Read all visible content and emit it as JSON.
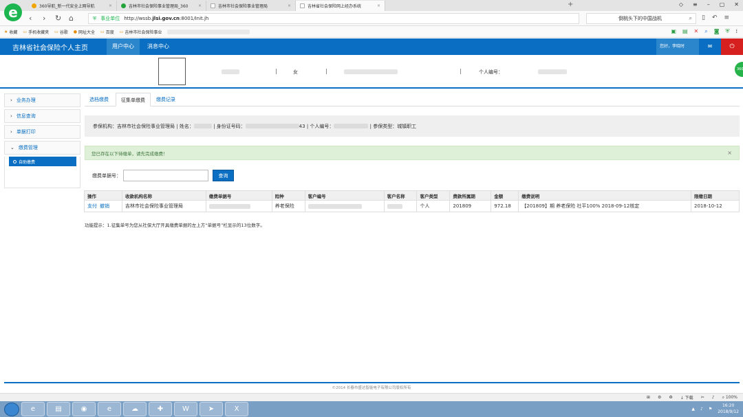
{
  "browser": {
    "tabs": [
      {
        "title": "360导航_新一代安全上网导航",
        "active": false
      },
      {
        "title": "吉林市社会保险事业管理局_360",
        "active": false
      },
      {
        "title": "吉林市社会保险事业管理局",
        "active": false
      },
      {
        "title": "吉林省社会保险网上经办系统",
        "active": true
      }
    ],
    "new_tab": "+",
    "url_secure": "事业单位",
    "url_prefix": "http://wssb.",
    "url_host": "jlsi.gov.cn",
    "url_suffix": ":8001/Init.jh",
    "search_text": "倒桃头下的中国战机",
    "bookmarks": [
      "收藏",
      "手机收藏夹",
      "谷歌",
      "网址大全",
      "百度",
      "吉林市社会保险事业"
    ]
  },
  "site": {
    "title": "吉林省社会保险个人主页",
    "nav": [
      {
        "label": "用户中心",
        "active": true
      },
      {
        "label": "消息中心",
        "active": false
      }
    ],
    "greeting": "您好，李晓时",
    "mail_icon": "envelope-icon",
    "power_icon": "power-icon"
  },
  "profile": {
    "gender": "女",
    "personal_no_label": "个人编号："
  },
  "sidebar": {
    "items": [
      {
        "label": "业务办理"
      },
      {
        "label": "信息查询"
      },
      {
        "label": "单据打印"
      },
      {
        "label": "缴费管理"
      }
    ],
    "sub_item": "自助缴费"
  },
  "main": {
    "tabs": [
      {
        "label": "选档缴费",
        "active": false
      },
      {
        "label": "征集单缴费",
        "active": true
      },
      {
        "label": "缴费记录",
        "active": false
      }
    ],
    "info": {
      "org_label": "参保机构：吉林市社会保险事业管理局",
      "name_label": "| 姓名：",
      "id_label": "| 身份证号码：",
      "id_tail": "43",
      "pno_label": "| 个人编号：",
      "type_label": "| 参保类型：城镇职工"
    },
    "alert": "您已存在以下待缴单，请先完成缴费！",
    "alert_close": "×",
    "bill_label": "缴费单据号：",
    "bill_value": "",
    "query_button": "查询",
    "table": {
      "headers": [
        "操作",
        "收款机构名称",
        "缴费单据号",
        "险种",
        "客户编号",
        "客户名称",
        "客户类型",
        "费款所属期",
        "金额",
        "缴费说明",
        "限缴日期"
      ],
      "rows": [
        {
          "pay": "支付",
          "cancel": "撤销",
          "org": "吉林市社会保险事业管理局",
          "insurance": "养老保险",
          "customer_type": "个人",
          "period": "201809",
          "amount": "972.18",
          "desc": "【201809】期 养老保险 社平100% 2018-09-12核定",
          "deadline": "2018-10-12"
        }
      ]
    },
    "tip": "功能提示：1.征集单号为您从社保大厅开具缴费单据的左上方“单据号”栏显示的13位数字。"
  },
  "footer": "©2014 长春市盛达智能电子有限公司版权所有",
  "statusbar": {
    "download": "下载",
    "zoom": "100%"
  },
  "taskbar": {
    "time": "16:20",
    "date": "2018/9/12"
  }
}
